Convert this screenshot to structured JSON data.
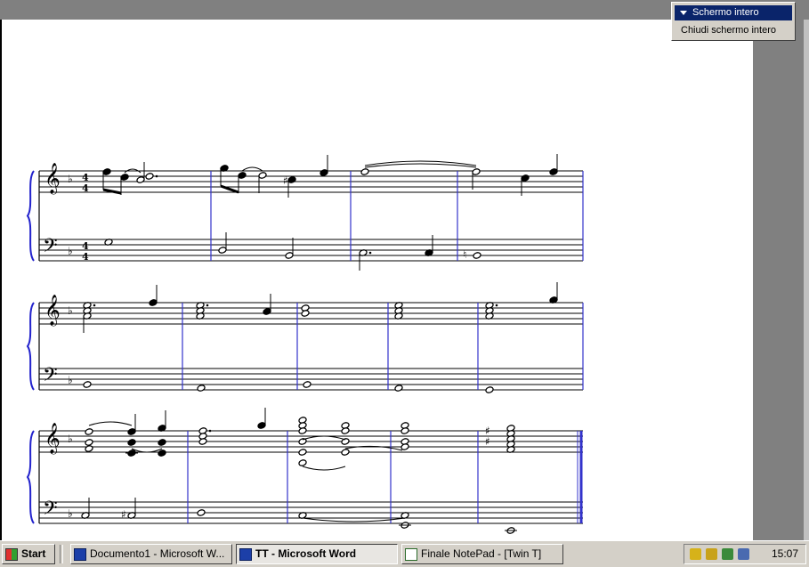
{
  "fullscreen_toolbar": {
    "title": "Schermo intero",
    "close_label": "Chiudi schermo intero"
  },
  "taskbar": {
    "start_label": "Start",
    "buttons": [
      {
        "label": "Documento1 - Microsoft W...",
        "active": false,
        "icon": "word-icon"
      },
      {
        "label": "TT - Microsoft Word",
        "active": true,
        "icon": "word-icon"
      },
      {
        "label": "Finale NotePad - [Twin T]",
        "active": false,
        "icon": "notepad-icon"
      }
    ],
    "clock": "15:07",
    "tray_icons": [
      "tray-pencil-icon",
      "tray-speaker-icon",
      "tray-network-icon",
      "tray-printer-icon"
    ]
  },
  "score": {
    "key_signature": "F major (one flat)",
    "time_signature": "4/4",
    "systems": 3,
    "measures_per_system": [
      4,
      5,
      5
    ]
  },
  "colors": {
    "barline": "#3333cc",
    "brace": "#2222cc",
    "desktop": "#808080",
    "taskbar": "#d4d0c8",
    "highlight": "#0a246a"
  }
}
